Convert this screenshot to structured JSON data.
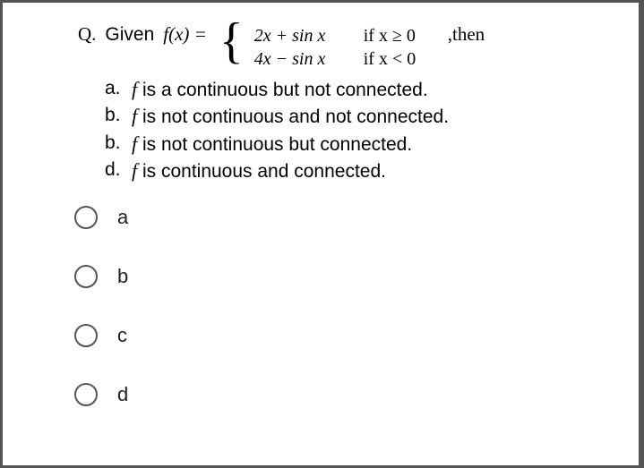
{
  "question": {
    "label": "Q.",
    "given": "Given",
    "fn_lhs": "f(x) =",
    "piece1_expr": "2x + sin x",
    "piece1_cond": "if  x ≥ 0",
    "piece2_expr": "4x − sin x",
    "piece2_cond": "if  x < 0",
    "then": ",then"
  },
  "answer_texts": {
    "a": {
      "label": "a.",
      "text_before": "",
      "fi": "f",
      "text_after": " is a continuous but not connected."
    },
    "b": {
      "label": "b.",
      "text_before": "",
      "fi": "f",
      "text_after": "  is not continuous and not connected."
    },
    "b2": {
      "label": "b.",
      "text_before": "",
      "fi": "f",
      "text_after": "  is not continuous but connected."
    },
    "d": {
      "label": "d.",
      "text_before": " ",
      "fi": "f",
      "text_after": "  is continuous and connected."
    }
  },
  "radio_options": [
    {
      "key": "a",
      "label": "a"
    },
    {
      "key": "b",
      "label": "b"
    },
    {
      "key": "c",
      "label": "c"
    },
    {
      "key": "d",
      "label": "d"
    }
  ]
}
